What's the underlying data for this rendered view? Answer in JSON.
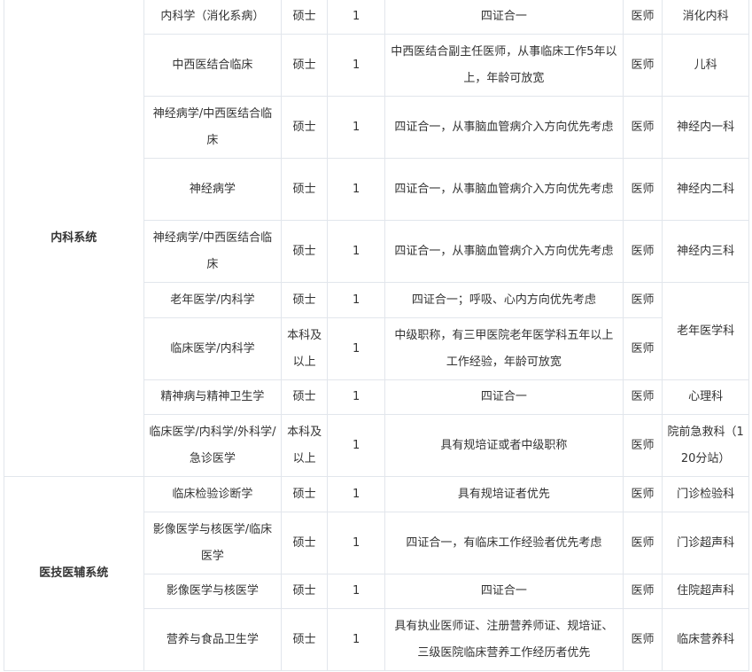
{
  "systems": {
    "internal": "内科系统",
    "tech": "医技医辅系统"
  },
  "rows": [
    {
      "major": "内科学（消化系病）",
      "degree": "硕士",
      "count": "1",
      "req": "四证合一",
      "post": "医师",
      "dept": "消化内科"
    },
    {
      "major": "中西医结合临床",
      "degree": "硕士",
      "count": "1",
      "req": "中西医结合副主任医师，从事临床工作5年以上，年龄可放宽",
      "post": "医师",
      "dept": "儿科"
    },
    {
      "major": "神经病学/中西医结合临床",
      "degree": "硕士",
      "count": "1",
      "req": "四证合一，从事脑血管病介入方向优先考虑",
      "post": "医师",
      "dept": "神经内一科"
    },
    {
      "major": "神经病学",
      "degree": "硕士",
      "count": "1",
      "req": "四证合一，从事脑血管病介入方向优先考虑",
      "post": "医师",
      "dept": "神经内二科"
    },
    {
      "major": "神经病学/中西医结合临床",
      "degree": "硕士",
      "count": "1",
      "req": "四证合一，从事脑血管病介入方向优先考虑",
      "post": "医师",
      "dept": "神经内三科"
    },
    {
      "major": "老年医学/内科学",
      "degree": "硕士",
      "count": "1",
      "req": "四证合一；呼吸、心内方向优先考虑",
      "post": "医师",
      "dept": "老年医学科"
    },
    {
      "major": "临床医学/内科学",
      "degree": "本科及以上",
      "count": "1",
      "req": "中级职称，有三甲医院老年医学科五年以上工作经验，年龄可放宽",
      "post": "医师",
      "dept": ""
    },
    {
      "major": "精神病与精神卫生学",
      "degree": "硕士",
      "count": "1",
      "req": "四证合一",
      "post": "医师",
      "dept": "心理科"
    },
    {
      "major": "临床医学/内科学/外科学/急诊医学",
      "degree": "本科及以上",
      "count": "1",
      "req": "具有规培证或者中级职称",
      "post": "医师",
      "dept": "院前急救科（120分站）"
    },
    {
      "major": "临床检验诊断学",
      "degree": "硕士",
      "count": "1",
      "req": "具有规培证者优先",
      "post": "医师",
      "dept": "门诊检验科"
    },
    {
      "major": "影像医学与核医学/临床医学",
      "degree": "硕士",
      "count": "1",
      "req": "四证合一，有临床工作经验者优先考虑",
      "post": "医师",
      "dept": "门诊超声科"
    },
    {
      "major": "影像医学与核医学",
      "degree": "硕士",
      "count": "1",
      "req": "四证合一",
      "post": "医师",
      "dept": "住院超声科"
    },
    {
      "major": "营养与食品卫生学",
      "degree": "硕士",
      "count": "1",
      "req": "具有执业医师证、注册营养师证、规培证、三级医院临床营养工作经历者优先",
      "post": "医师",
      "dept": "临床营养科"
    }
  ]
}
